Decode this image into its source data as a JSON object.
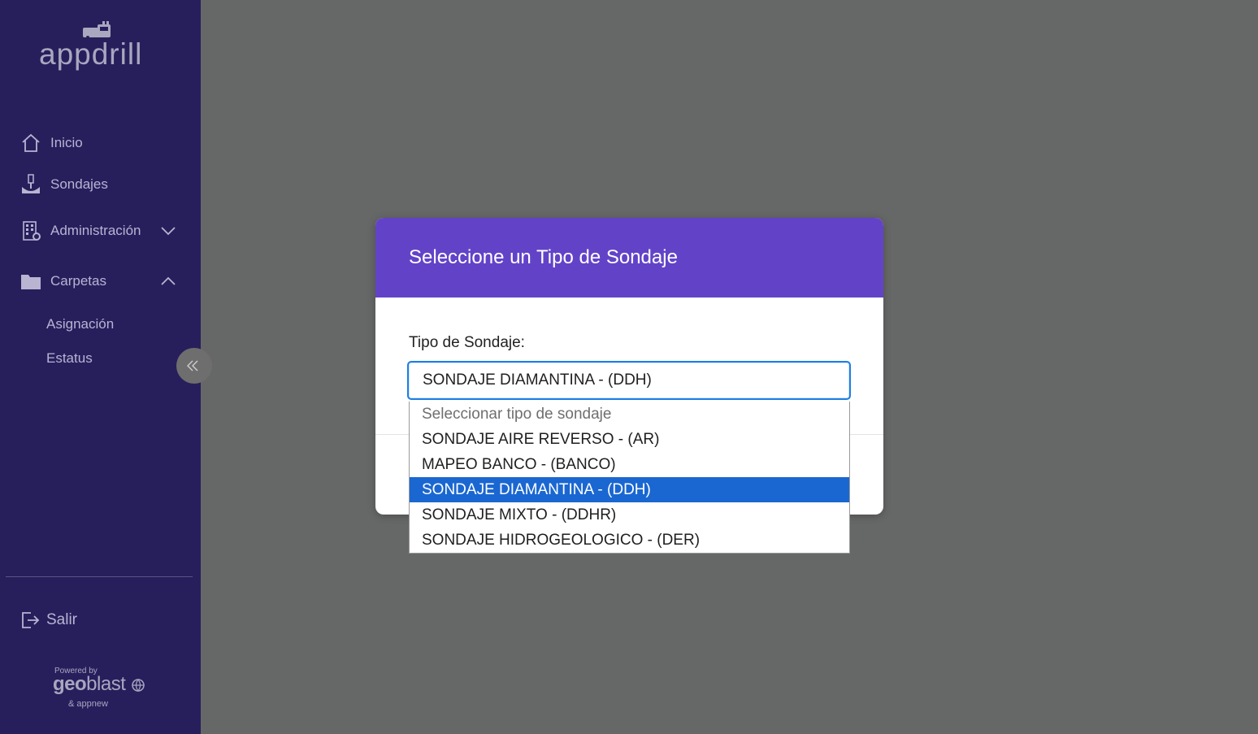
{
  "app": {
    "logo_text": "appdrill"
  },
  "sidebar": {
    "items": [
      {
        "label": "Inicio",
        "icon": "home-icon"
      },
      {
        "label": "Sondajes",
        "icon": "drill-icon"
      },
      {
        "label": "Administración",
        "icon": "building-gear-icon"
      },
      {
        "label": "Carpetas",
        "icon": "folder-icon"
      }
    ],
    "sub_items": [
      {
        "label": "Asignación"
      },
      {
        "label": "Estatus"
      }
    ],
    "logout_label": "Salir",
    "powered": {
      "small": "Powered by",
      "brand_bold": "geo",
      "brand_thin": "blast",
      "sub": "& appnew"
    }
  },
  "modal": {
    "title": "Seleccione un Tipo de Sondaje",
    "field_label": "Tipo de Sondaje:",
    "selected_value": "SONDAJE DIAMANTINA - (DDH)",
    "options": [
      {
        "label": "Seleccionar tipo de sondaje"
      },
      {
        "label": "SONDAJE AIRE REVERSO - (AR)"
      },
      {
        "label": "MAPEO BANCO - (BANCO)"
      },
      {
        "label": "SONDAJE DIAMANTINA - (DDH)"
      },
      {
        "label": "SONDAJE MIXTO - (DDHR)"
      },
      {
        "label": "SONDAJE HIDROGEOLOGICO - (DER)"
      }
    ]
  },
  "colors": {
    "sidebar_bg": "#271f5c",
    "modal_header": "#6243c8",
    "selected_option": "#1a67d2",
    "overlay": "#666867"
  }
}
